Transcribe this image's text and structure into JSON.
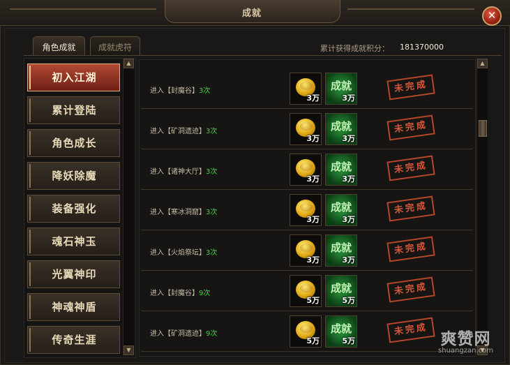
{
  "window": {
    "title": "成就"
  },
  "tabs": [
    {
      "label": "角色成就",
      "active": true
    },
    {
      "label": "成就虎符",
      "active": false
    }
  ],
  "score": {
    "label": "累计获得成就积分：",
    "value": "181370000"
  },
  "categories": [
    {
      "label": "初入江湖",
      "active": true
    },
    {
      "label": "累计登陆",
      "active": false
    },
    {
      "label": "角色成长",
      "active": false
    },
    {
      "label": "降妖除魔",
      "active": false
    },
    {
      "label": "装备强化",
      "active": false
    },
    {
      "label": "魂石神玉",
      "active": false
    },
    {
      "label": "光翼神印",
      "active": false
    },
    {
      "label": "神魂神盾",
      "active": false
    },
    {
      "label": "传奇生涯",
      "active": false
    }
  ],
  "achievements": [
    {
      "task": "进入【封魔谷】",
      "count": "3次",
      "gold_reward": "3万",
      "achievement_reward": "3万",
      "achievement_icon_text": "成就",
      "status": "未完成"
    },
    {
      "task": "进入【矿洞遗迹】",
      "count": "3次",
      "gold_reward": "3万",
      "achievement_reward": "3万",
      "achievement_icon_text": "成就",
      "status": "未完成"
    },
    {
      "task": "进入【诸神大厅】",
      "count": "3次",
      "gold_reward": "3万",
      "achievement_reward": "3万",
      "achievement_icon_text": "成就",
      "status": "未完成"
    },
    {
      "task": "进入【寒冰洞窟】",
      "count": "3次",
      "gold_reward": "3万",
      "achievement_reward": "3万",
      "achievement_icon_text": "成就",
      "status": "未完成"
    },
    {
      "task": "进入【火焰祭坛】",
      "count": "3次",
      "gold_reward": "3万",
      "achievement_reward": "3万",
      "achievement_icon_text": "成就",
      "status": "未完成"
    },
    {
      "task": "进入【封魔谷】",
      "count": "9次",
      "gold_reward": "5万",
      "achievement_reward": "5万",
      "achievement_icon_text": "成就",
      "status": "未完成"
    },
    {
      "task": "进入【矿洞遗迹】",
      "count": "9次",
      "gold_reward": "5万",
      "achievement_reward": "5万",
      "achievement_icon_text": "成就",
      "status": "未完成"
    }
  ],
  "watermark": {
    "logo": "爽赞网",
    "url": "shuangzan.com"
  },
  "colors": {
    "count_green": "#3fd23f",
    "stamp_red": "#d5583a",
    "active_tab_red": "#b24a34"
  },
  "icons": {
    "close": "close-icon",
    "gold": "gold-coin-icon",
    "achievement": "achievement-badge-icon",
    "scroll_up": "scroll-up-arrow-icon",
    "scroll_down": "scroll-down-arrow-icon"
  }
}
